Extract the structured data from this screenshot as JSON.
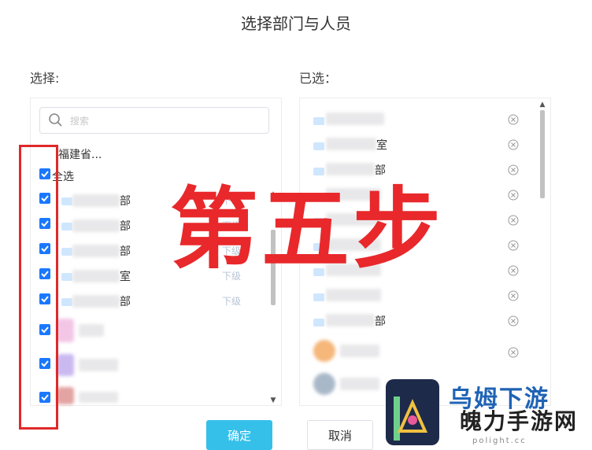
{
  "dialog": {
    "title": "选择部门与人员",
    "left_label": "选择:",
    "right_label": "已选：",
    "search_placeholder": "搜索",
    "breadcrumb": "福建省...",
    "select_all": "全选",
    "confirm_label": "确定",
    "cancel_label": "取消"
  },
  "left_items": [
    {
      "suffix": "部",
      "action": "下级",
      "checked": true
    },
    {
      "suffix": "部",
      "action": "下级",
      "checked": true
    },
    {
      "suffix": "部",
      "action": "下级",
      "checked": true
    },
    {
      "suffix": "室",
      "action": "下级",
      "checked": true
    },
    {
      "suffix": "部",
      "action": "下级",
      "checked": true
    },
    {
      "suffix": "",
      "action": "",
      "checked": true
    },
    {
      "suffix": "",
      "action": "",
      "checked": true
    },
    {
      "suffix": "",
      "action": "",
      "checked": true
    }
  ],
  "right_items": [
    {
      "suffix": ""
    },
    {
      "suffix": "室"
    },
    {
      "suffix": "部"
    },
    {
      "suffix": ""
    },
    {
      "suffix": ""
    },
    {
      "suffix": ""
    },
    {
      "suffix": ""
    },
    {
      "suffix": ""
    },
    {
      "suffix": "部"
    },
    {
      "suffix": ""
    },
    {
      "suffix": ""
    }
  ],
  "annotation": {
    "step_text": "第五步"
  },
  "watermark": {
    "top_text": "乌姆下游",
    "brand": "魄力手游网",
    "url": "polight.cc"
  },
  "colors": {
    "primary": "#35c0ea",
    "checkbox": "#1a78ff",
    "annotation": "#e8282b"
  }
}
